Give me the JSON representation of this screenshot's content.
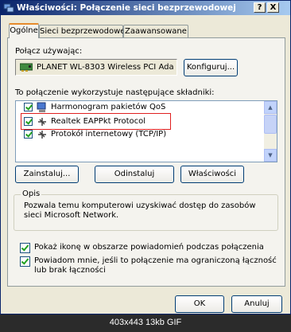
{
  "window": {
    "title": "Właściwości: Połączenie sieci bezprzewodowej",
    "help_button": "?",
    "close_button": "X"
  },
  "tabs": [
    {
      "label": "Ogólne",
      "active": true
    },
    {
      "label": "Sieci bezprzewodowe",
      "active": false
    },
    {
      "label": "Zaawansowane",
      "active": false
    }
  ],
  "connect_using": {
    "label": "Połącz używając:",
    "adapter": "PLANET WL-8303 Wireless PCI Ada",
    "configure_button": "Konfiguruj..."
  },
  "components": {
    "label": "To połączenie wykorzystuje następujące składniki:",
    "items": [
      {
        "label": "Harmonogram pakietów QoS",
        "checked": true,
        "icon": "network-service-icon"
      },
      {
        "label": "Realtek EAPPkt Protocol",
        "checked": true,
        "icon": "protocol-icon"
      },
      {
        "label": "Protokół internetowy (TCP/IP)",
        "checked": true,
        "icon": "protocol-icon"
      }
    ],
    "install_button": "Zainstaluj...",
    "uninstall_button": "Odinstaluj",
    "properties_button": "Właściwości"
  },
  "description": {
    "caption": "Opis",
    "text": "Pozwala temu komputerowi uzyskiwać dostęp do zasobów sieci Microsoft Network."
  },
  "options": {
    "show_icon": {
      "label": "Pokaż ikonę w obszarze powiadomień podczas połączenia",
      "checked": true
    },
    "notify_limited": {
      "label": "Powiadom mnie, jeśli to połączenie ma ograniczoną łączność lub brak łączności",
      "checked": true
    }
  },
  "dialog_buttons": {
    "ok": "OK",
    "cancel": "Anuluj"
  },
  "image_status": "403x443 13kb GIF",
  "colors": {
    "titlebar_start": "#0a246a",
    "titlebar_end": "#a6caf0",
    "highlight_box": "#e02020"
  }
}
